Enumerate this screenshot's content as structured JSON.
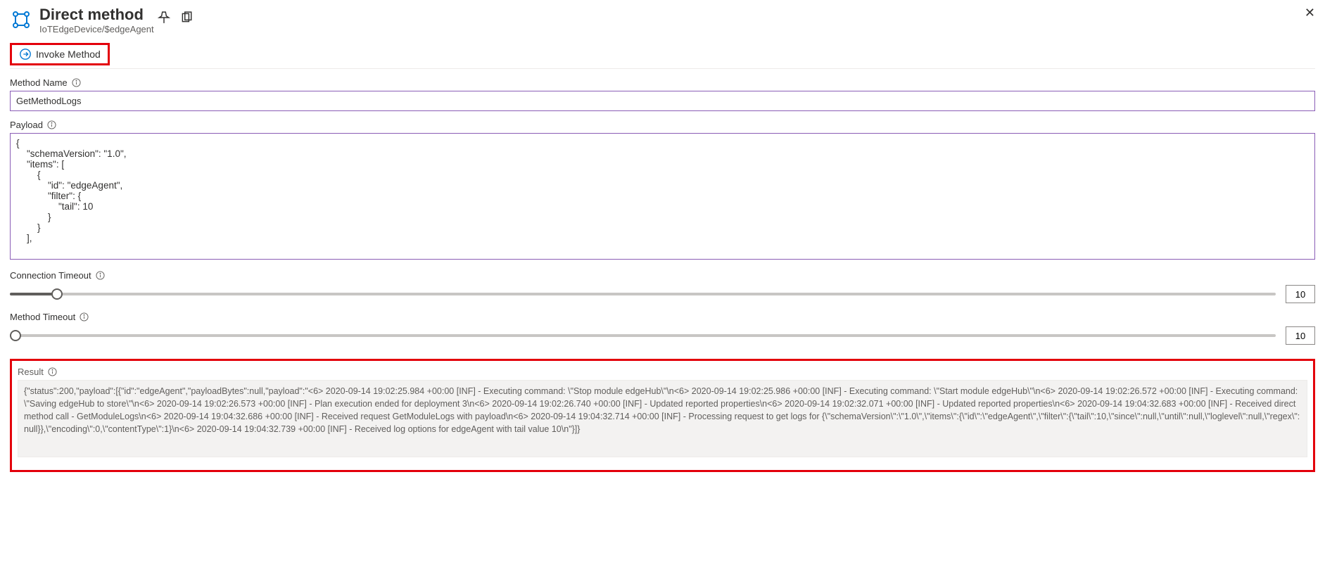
{
  "header": {
    "title": "Direct method",
    "breadcrumb": "IoTEdgeDevice/$edgeAgent"
  },
  "toolbar": {
    "invoke_label": "Invoke Method"
  },
  "methodName": {
    "label": "Method Name",
    "value": "GetMethodLogs"
  },
  "payload": {
    "label": "Payload",
    "value": "{\n    \"schemaVersion\": \"1.0\",\n    \"items\": [\n        {\n            \"id\": \"edgeAgent\",\n            \"filter\": {\n                \"tail\": 10\n            }\n        }\n    ],"
  },
  "connectionTimeout": {
    "label": "Connection Timeout",
    "value": "10",
    "min": "0",
    "max": "300"
  },
  "methodTimeout": {
    "label": "Method Timeout",
    "value": "10",
    "min": "10",
    "max": "300"
  },
  "result": {
    "label": "Result",
    "value": "{\"status\":200,\"payload\":[{\"id\":\"edgeAgent\",\"payloadBytes\":null,\"payload\":\"<6> 2020-09-14 19:02:25.984 +00:00 [INF] - Executing command: \\\"Stop module edgeHub\\\"\\n<6> 2020-09-14 19:02:25.986 +00:00 [INF] - Executing command: \\\"Start module edgeHub\\\"\\n<6> 2020-09-14 19:02:26.572 +00:00 [INF] - Executing command: \\\"Saving edgeHub to store\\\"\\n<6> 2020-09-14 19:02:26.573 +00:00 [INF] - Plan execution ended for deployment 3\\n<6> 2020-09-14 19:02:26.740 +00:00 [INF] - Updated reported properties\\n<6> 2020-09-14 19:02:32.071 +00:00 [INF] - Updated reported properties\\n<6> 2020-09-14 19:04:32.683 +00:00 [INF] - Received direct method call - GetModuleLogs\\n<6> 2020-09-14 19:04:32.686 +00:00 [INF] - Received request GetModuleLogs with payload\\n<6> 2020-09-14 19:04:32.714 +00:00 [INF] - Processing request to get logs for {\\\"schemaVersion\\\":\\\"1.0\\\",\\\"items\\\":{\\\"id\\\":\\\"edgeAgent\\\",\\\"filter\\\":{\\\"tail\\\":10,\\\"since\\\":null,\\\"until\\\":null,\\\"loglevel\\\":null,\\\"regex\\\":null}},\\\"encoding\\\":0,\\\"contentType\\\":1}\\n<6> 2020-09-14 19:04:32.739 +00:00 [INF] - Received log options for edgeAgent with tail value 10\\n\"}]}"
  }
}
